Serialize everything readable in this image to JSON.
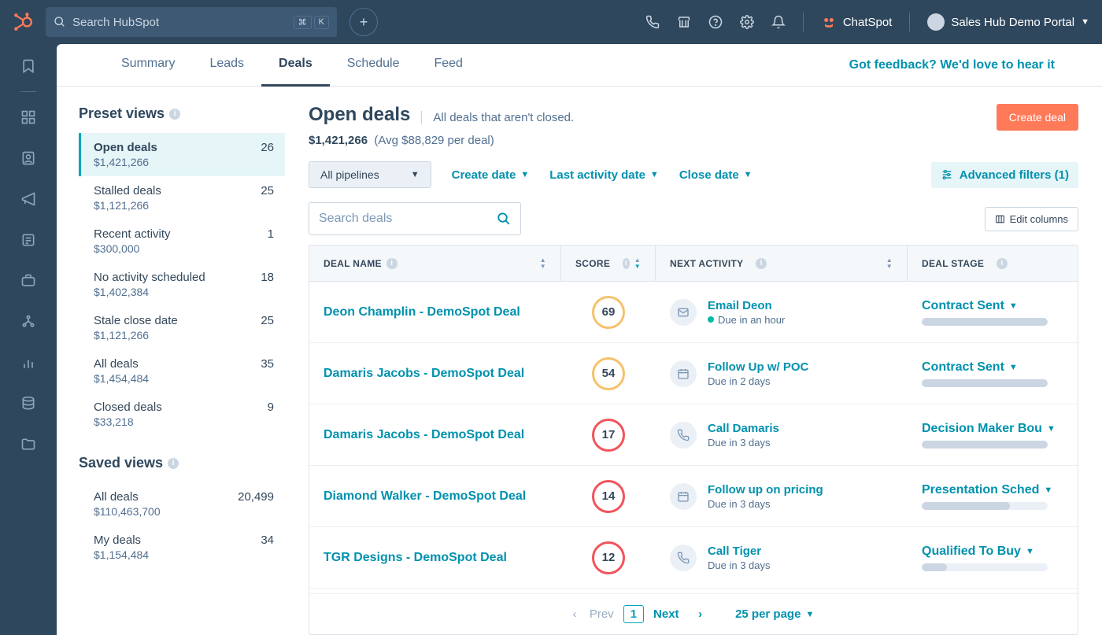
{
  "topbar": {
    "search_placeholder": "Search HubSpot",
    "kbd1": "⌘",
    "kbd2": "K",
    "chatspot_label": "ChatSpot",
    "portal_label": "Sales Hub Demo Portal"
  },
  "tabs": {
    "items": [
      "Summary",
      "Leads",
      "Deals",
      "Schedule",
      "Feed"
    ],
    "active_index": 2,
    "feedback": "Got feedback? We'd love to hear it"
  },
  "sidebar": {
    "preset_title": "Preset views",
    "saved_title": "Saved views",
    "preset_views": [
      {
        "name": "Open deals",
        "count": "26",
        "amount": "$1,421,266",
        "active": true
      },
      {
        "name": "Stalled deals",
        "count": "25",
        "amount": "$1,121,266"
      },
      {
        "name": "Recent activity",
        "count": "1",
        "amount": "$300,000"
      },
      {
        "name": "No activity scheduled",
        "count": "18",
        "amount": "$1,402,384"
      },
      {
        "name": "Stale close date",
        "count": "25",
        "amount": "$1,121,266"
      },
      {
        "name": "All deals",
        "count": "35",
        "amount": "$1,454,484"
      },
      {
        "name": "Closed deals",
        "count": "9",
        "amount": "$33,218"
      }
    ],
    "saved_views": [
      {
        "name": "All deals",
        "count": "20,499",
        "amount": "$110,463,700"
      },
      {
        "name": "My deals",
        "count": "34",
        "amount": "$1,154,484"
      }
    ]
  },
  "work": {
    "title": "Open deals",
    "subtitle": "All deals that aren't closed.",
    "total": "$1,421,266",
    "avg": "(Avg $88,829 per deal)",
    "create_label": "Create deal",
    "pipeline_label": "All pipelines",
    "filters": {
      "create_date": "Create date",
      "last_activity": "Last activity date",
      "close_date": "Close date",
      "advanced": "Advanced filters (1)"
    },
    "search_placeholder": "Search deals",
    "edit_columns": "Edit columns",
    "columns": {
      "name": "DEAL NAME",
      "score": "SCORE",
      "activity": "NEXT ACTIVITY",
      "stage": "DEAL STAGE"
    },
    "rows": [
      {
        "name": "Deon Champlin - DemoSpot Deal",
        "score": 69,
        "score_color": "yellow",
        "act_icon": "mail",
        "act_title": "Email Deon",
        "act_meta": "Due in an hour",
        "green_dot": true,
        "stage": "Contract Sent",
        "stage_pct": 100
      },
      {
        "name": "Damaris Jacobs - DemoSpot Deal",
        "score": 54,
        "score_color": "yellow",
        "act_icon": "cal",
        "act_title": "Follow Up w/ POC",
        "act_meta": "Due in 2 days",
        "stage": "Contract Sent",
        "stage_pct": 100
      },
      {
        "name": "Damaris Jacobs - DemoSpot Deal",
        "score": 17,
        "score_color": "red",
        "act_icon": "phone",
        "act_title": "Call Damaris",
        "act_meta": "Due in 3 days",
        "stage": "Decision Maker Bou",
        "stage_pct": 100
      },
      {
        "name": "Diamond Walker - DemoSpot Deal",
        "score": 14,
        "score_color": "red",
        "act_icon": "cal",
        "act_title": "Follow up on pricing",
        "act_meta": "Due in 3 days",
        "stage": "Presentation Sched",
        "stage_pct": 70
      },
      {
        "name": "TGR Designs - DemoSpot Deal",
        "score": 12,
        "score_color": "red",
        "act_icon": "phone",
        "act_title": "Call Tiger",
        "act_meta": "Due in 3 days",
        "stage": "Qualified To Buy",
        "stage_pct": 20
      }
    ],
    "pager": {
      "prev": "Prev",
      "page": "1",
      "next": "Next",
      "per_page": "25 per page"
    }
  }
}
